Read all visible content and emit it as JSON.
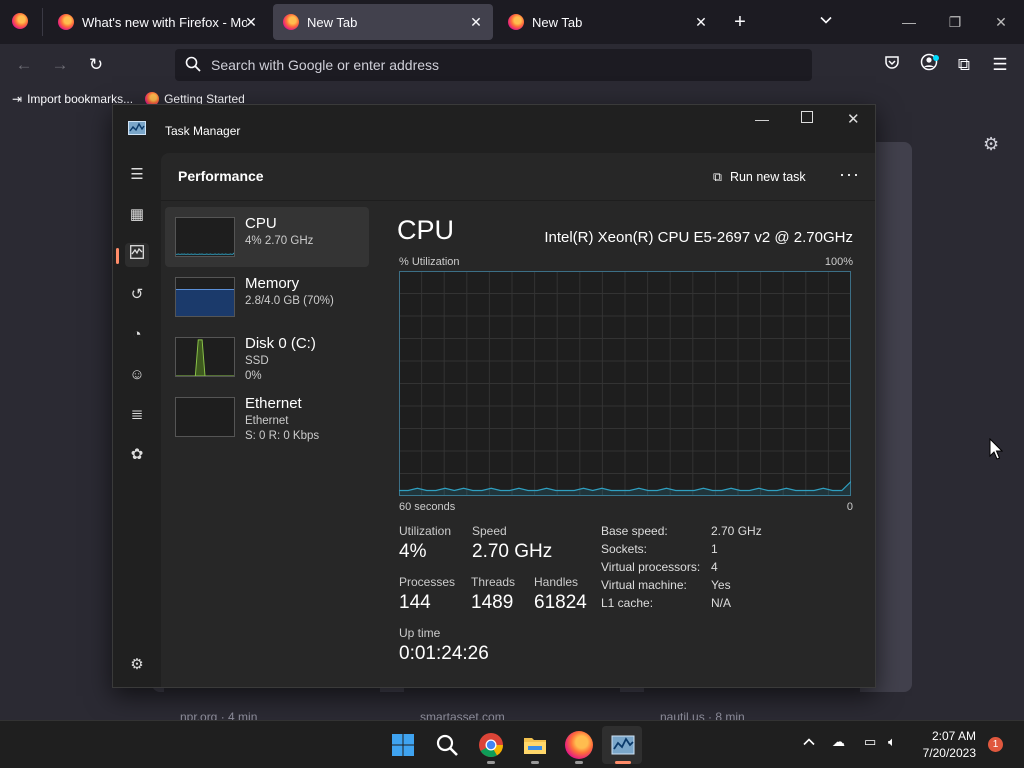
{
  "browser": {
    "tabs": [
      {
        "title": "What's new with Firefox - More",
        "active": false
      },
      {
        "title": "New Tab",
        "active": true
      },
      {
        "title": "New Tab",
        "active": false
      }
    ],
    "url_placeholder": "Search with Google or enter address",
    "bookmarks": [
      "Import bookmarks...",
      "Getting Started"
    ],
    "newtab_sources": [
      "npr.org · 4 min",
      "smartasset.com",
      "nautil.us · 8 min"
    ]
  },
  "taskmanager": {
    "title": "Task Manager",
    "section": "Performance",
    "run_new_task": "Run new task",
    "resources": [
      {
        "name": "CPU",
        "line1": "4% 2.70 GHz",
        "line2": ""
      },
      {
        "name": "Memory",
        "line1": "2.8/4.0 GB (70%)",
        "line2": ""
      },
      {
        "name": "Disk 0 (C:)",
        "line1": "SSD",
        "line2": "0%"
      },
      {
        "name": "Ethernet",
        "line1": "Ethernet",
        "line2": "S: 0 R: 0 Kbps"
      }
    ],
    "detail": {
      "heading": "CPU",
      "model": "Intel(R) Xeon(R) CPU E5-2697 v2 @ 2.70GHz",
      "graph_label": "% Utilization",
      "graph_max": "100%",
      "graph_time": "60 seconds",
      "graph_min": "0",
      "stats": {
        "utilization_label": "Utilization",
        "utilization": "4%",
        "speed_label": "Speed",
        "speed": "2.70 GHz",
        "processes_label": "Processes",
        "processes": "144",
        "threads_label": "Threads",
        "threads": "1489",
        "handles_label": "Handles",
        "handles": "61824",
        "uptime_label": "Up time",
        "uptime": "0:01:24:26"
      },
      "specs": [
        {
          "key": "Base speed:",
          "value": "2.70 GHz"
        },
        {
          "key": "Sockets:",
          "value": "1"
        },
        {
          "key": "Virtual processors:",
          "value": "4"
        },
        {
          "key": "Virtual machine:",
          "value": "Yes"
        },
        {
          "key": "L1 cache:",
          "value": "N/A"
        }
      ]
    },
    "cpu_history_percent": [
      2,
      2,
      3,
      2,
      2,
      3,
      2,
      3,
      2,
      2,
      3,
      2,
      2,
      3,
      2,
      2,
      3,
      2,
      2,
      2,
      3,
      2,
      3,
      2,
      2,
      2,
      3,
      2,
      2,
      3,
      2,
      2,
      2,
      3,
      2,
      2,
      3,
      2,
      2,
      3,
      2,
      2,
      3,
      2,
      2,
      2,
      3,
      2,
      2,
      6
    ]
  },
  "taskbar": {
    "time": "2:07 AM",
    "date": "7/20/2023",
    "notifications": "1"
  },
  "colors": {
    "firefox_bg": "#1c1b22",
    "cpu_line": "#2f9fc0",
    "memory_fill": "#1b3a6b",
    "disk_fill": "#8bc34a"
  }
}
